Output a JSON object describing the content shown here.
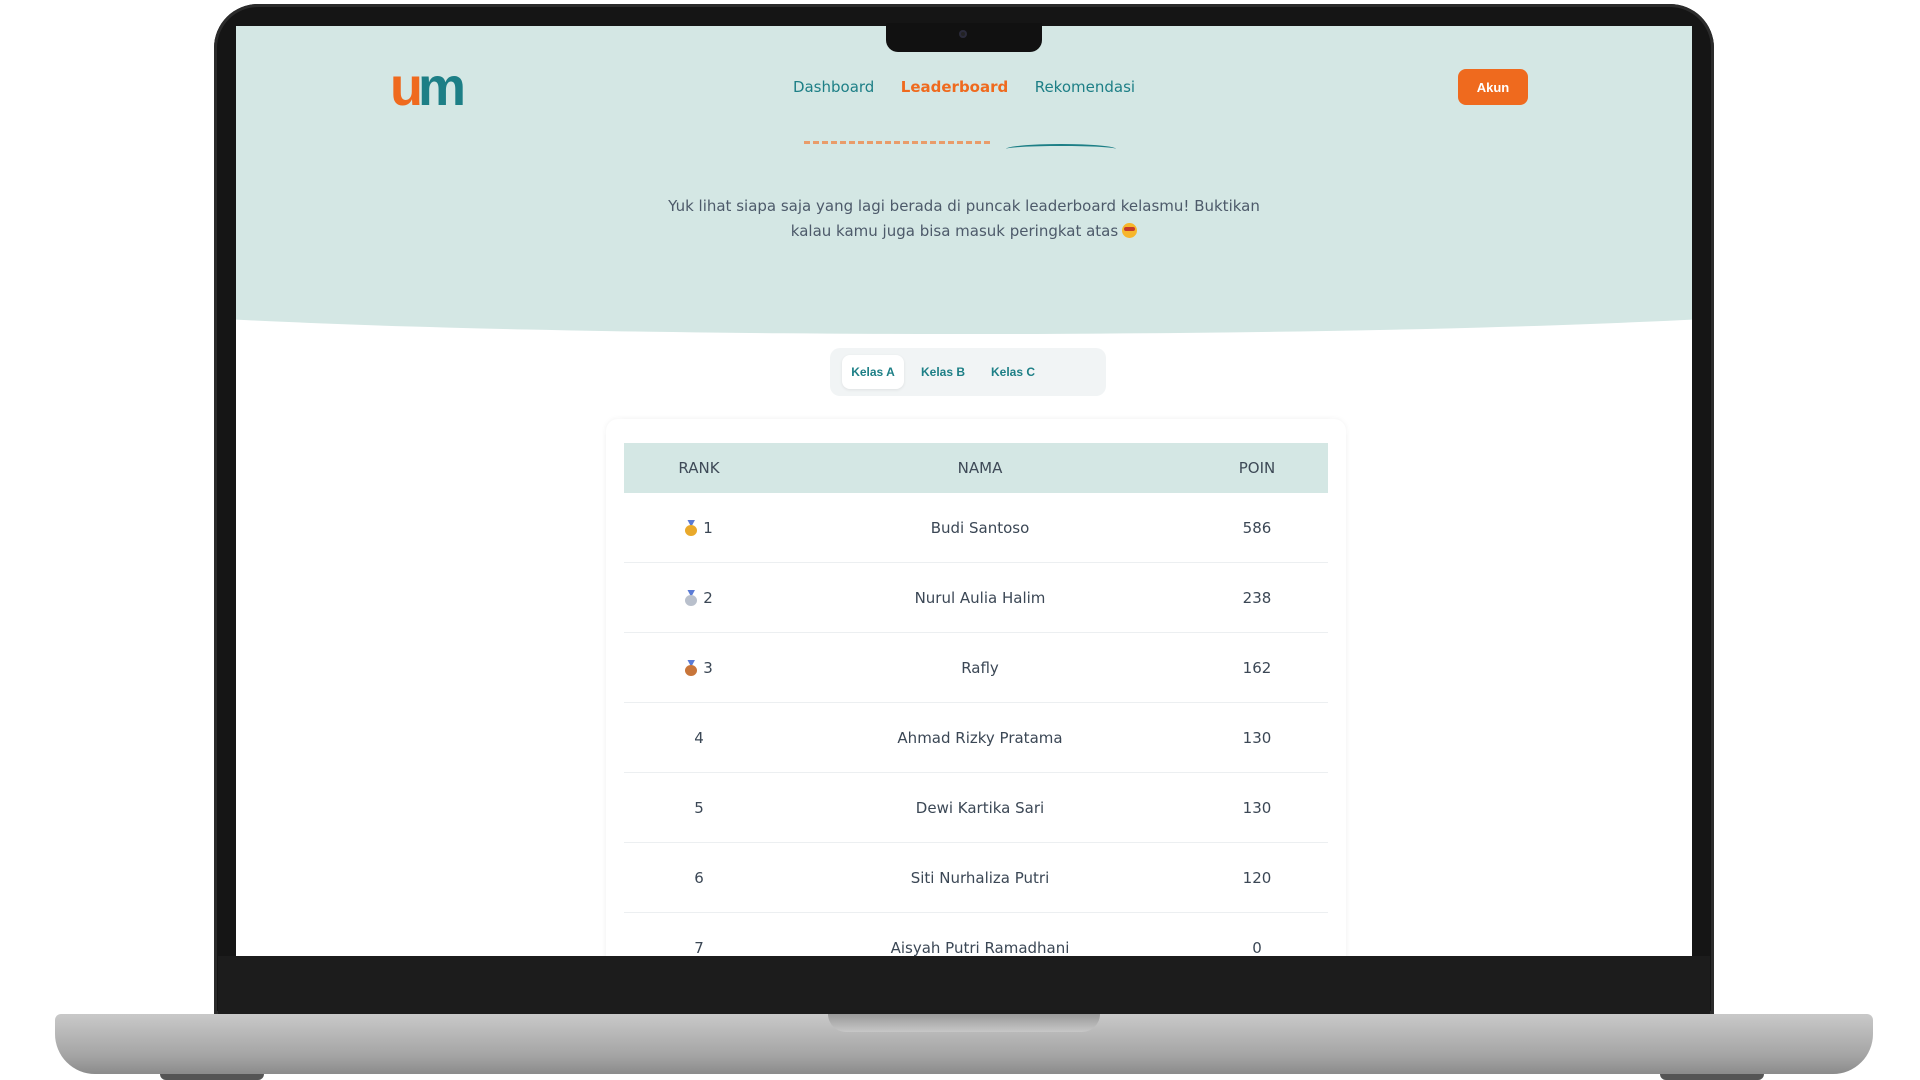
{
  "nav": {
    "logo": {
      "u": "u",
      "m": "m"
    },
    "links": [
      "Dashboard",
      "Leaderboard",
      "Rekomendasi"
    ],
    "active": "Leaderboard",
    "account_label": "Akun"
  },
  "hero": {
    "subtitle_line1": "Yuk lihat siapa saja yang lagi berada di puncak leaderboard kelasmu! Buktikan",
    "subtitle_line2": "kalau kamu juga bisa masuk peringkat atas"
  },
  "tabs": [
    "Kelas A",
    "Kelas B",
    "Kelas C"
  ],
  "active_tab": "Kelas A",
  "table": {
    "headers": [
      "RANK",
      "NAMA",
      "POIN"
    ],
    "rows": [
      {
        "rank": "1",
        "medal": "gold",
        "name": "Budi Santoso",
        "points": "586"
      },
      {
        "rank": "2",
        "medal": "silver",
        "name": "Nurul Aulia Halim",
        "points": "238"
      },
      {
        "rank": "3",
        "medal": "bronze",
        "name": "Rafly",
        "points": "162"
      },
      {
        "rank": "4",
        "medal": "",
        "name": "Ahmad Rizky Pratama",
        "points": "130"
      },
      {
        "rank": "5",
        "medal": "",
        "name": "Dewi Kartika Sari",
        "points": "130"
      },
      {
        "rank": "6",
        "medal": "",
        "name": "Siti Nurhaliza Putri",
        "points": "120"
      },
      {
        "rank": "7",
        "medal": "",
        "name": "Aisyah Putri Ramadhani",
        "points": "0"
      }
    ]
  },
  "colors": {
    "accent": "#ef6a1e",
    "teal": "#1d7f86",
    "hero_bg": "#d4e7e4"
  }
}
